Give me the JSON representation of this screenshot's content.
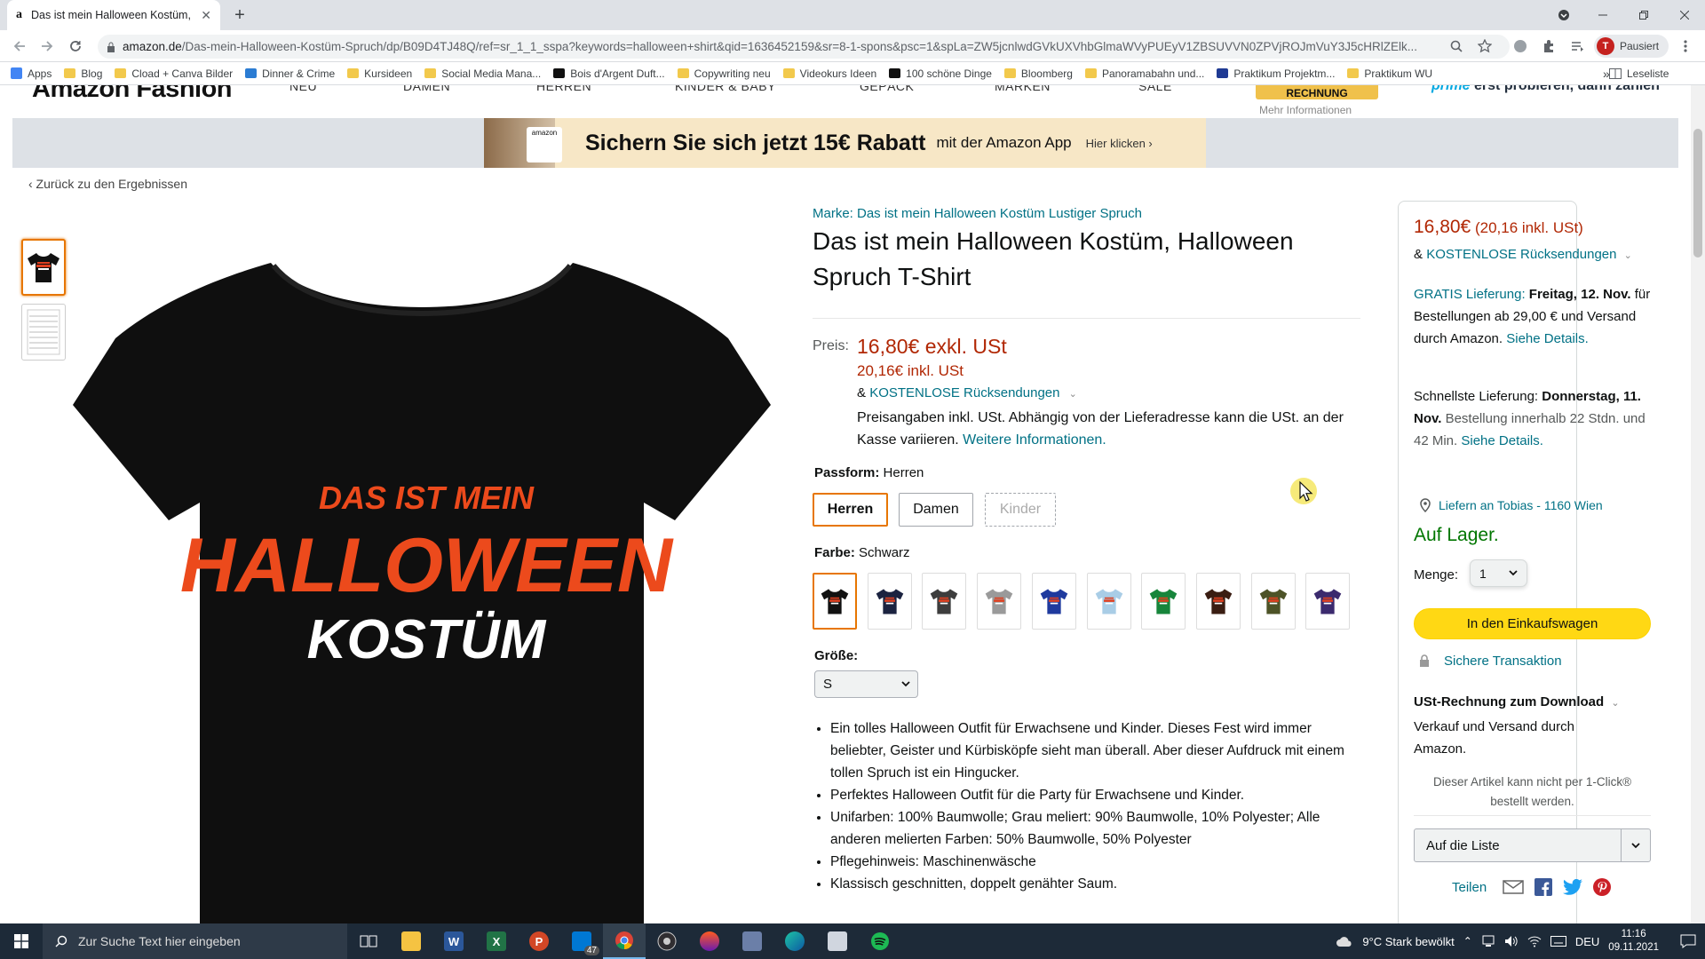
{
  "browser": {
    "tab_title": "Das ist mein Halloween Kostüm,",
    "favicon_letter": "a",
    "url_domain": "amazon.de",
    "url_path": "/Das-mein-Halloween-Kostüm-Spruch/dp/B09D4TJ48Q/ref=sr_1_1_sspa?keywords=halloween+shirt&qid=1636452159&sr=8-1-spons&psc=1&spLa=ZW5jcnlwdGVkUXVhbGlmaWVyPUEyV1ZBSUVVN0ZPVjROJmVuY3J5cHRlZElk...",
    "profile_initial": "T",
    "profile_label": "Pausiert",
    "bookmarks": [
      {
        "label": "Apps",
        "color": "#4285f4"
      },
      {
        "label": "Blog",
        "color": "#f2c94c"
      },
      {
        "label": "Cload + Canva Bilder",
        "color": "#f2c94c"
      },
      {
        "label": "Dinner & Crime",
        "color": "#2b7cd3"
      },
      {
        "label": "Kursideen",
        "color": "#f2c94c"
      },
      {
        "label": "Social Media Mana...",
        "color": "#f2c94c"
      },
      {
        "label": "Bois d'Argent Duft...",
        "color": "#111111"
      },
      {
        "label": "Copywriting neu",
        "color": "#f2c94c"
      },
      {
        "label": "Videokurs Ideen",
        "color": "#f2c94c"
      },
      {
        "label": "100 schöne Dinge",
        "color": "#111111"
      },
      {
        "label": "Bloomberg",
        "color": "#f2c94c"
      },
      {
        "label": "Panoramabahn und...",
        "color": "#f2c94c"
      },
      {
        "label": "Praktikum Projektm...",
        "color": "#1f3a93"
      },
      {
        "label": "Praktikum WU",
        "color": "#f2c94c"
      }
    ],
    "bookmarks_more": "»",
    "reading_list": "Leseliste"
  },
  "store_header": {
    "logo": "Amazon Fashion",
    "nav": [
      "NEU",
      "DAMEN",
      "HERREN",
      "KINDER & BABY",
      "GEPÄCK",
      "MARKEN",
      "SALE"
    ],
    "invoice_badge": "RECHNUNG",
    "invoice_sub": "Mehr Informationen",
    "prime_word": "prime",
    "prime_text": " erst probieren, dann zahlen"
  },
  "promo": {
    "headline": "Sichern Sie sich jetzt 15€ Rabatt",
    "sub": "mit der Amazon App",
    "cta": "Hier klicken ›"
  },
  "back_link": "‹  Zurück zu den Ergebnissen",
  "product": {
    "brand": "Marke: Das ist mein Halloween Kostüm Lustiger Spruch",
    "title": "Das ist mein Halloween Kostüm, Halloween Spruch T-Shirt",
    "print_line1": "DAS IST MEIN",
    "print_line2": "HALLOWEEN",
    "print_line3": "KOSTÜM",
    "price_label": "Preis:",
    "price_main": "16,80€ exkl. USt",
    "price_incl": "20,16€ inkl. USt",
    "returns_prefix": "& ",
    "returns_link": "KOSTENLOSE Rücksendungen",
    "price_note": "Preisangaben inkl. USt. Abhängig von der Lieferadresse kann die USt. an der Kasse variieren.",
    "price_note_link": "Weitere Informationen.",
    "fit_label": "Passform:",
    "fit_value": "Herren",
    "fit_options": [
      "Herren",
      "Damen",
      "Kinder"
    ],
    "color_label": "Farbe:",
    "color_value": "Schwarz",
    "colors": [
      "#111111",
      "#1b2340",
      "#3d3d3d",
      "#9a9a9a",
      "#1f3a9e",
      "#a9cde6",
      "#17853b",
      "#3a1d12",
      "#4d5327",
      "#3b2a6e"
    ],
    "size_label": "Größe:",
    "size_value": "S",
    "bullets": [
      "Ein tolles Halloween Outfit für Erwachsene und Kinder. Dieses Fest wird immer beliebter, Geister und Kürbisköpfe sieht man überall. Aber dieser Aufdruck mit einem tollen Spruch ist ein Hingucker.",
      "Perfektes Halloween Outfit für die Party für Erwachsene und Kinder.",
      "Unifarben: 100% Baumwolle; Grau meliert: 90% Baumwolle, 10% Polyester; Alle anderen melierten Farben: 50% Baumwolle, 50% Polyester",
      "Pflegehinweis: Maschinenwäsche",
      "Klassisch geschnitten, doppelt genähter Saum."
    ]
  },
  "buybox": {
    "price": "16,80€",
    "price_incl": " (20,16 inkl. USt)",
    "returns_prefix": "& ",
    "returns_link": "KOSTENLOSE Rücksendungen",
    "delivery_link": "GRATIS Lieferung:",
    "delivery_date": " Freitag, 12. Nov.",
    "delivery_text": " für Bestellungen ab 29,00 € und Versand durch Amazon. ",
    "delivery_details": "Siehe Details.",
    "fast_label": "Schnellste Lieferung:",
    "fast_date": " Donnerstag, 11. Nov.",
    "fast_text": " Bestellung innerhalb 22 Stdn. und 42 Min. ",
    "fast_details": "Siehe Details.",
    "location": "Liefern an Tobias - 1160 Wien",
    "stock": "Auf Lager.",
    "qty_label": "Menge:",
    "qty_value": "1",
    "cart_button": "In den Einkaufswagen",
    "secure": "Sichere Transaktion",
    "invoice": "USt-Rechnung zum Download",
    "seller": "Verkauf und Versand durch Amazon.",
    "oneclick": "Dieser Artikel kann nicht per 1-Click® bestellt werden.",
    "list_button": "Auf die Liste",
    "share": "Teilen"
  },
  "taskbar": {
    "search_placeholder": "Zur Suche Text hier eingeben",
    "mail_badge": "47",
    "weather": "9°C  Stark bewölkt",
    "lang": "DEU",
    "time": "11:16",
    "date": "09.11.2021"
  }
}
